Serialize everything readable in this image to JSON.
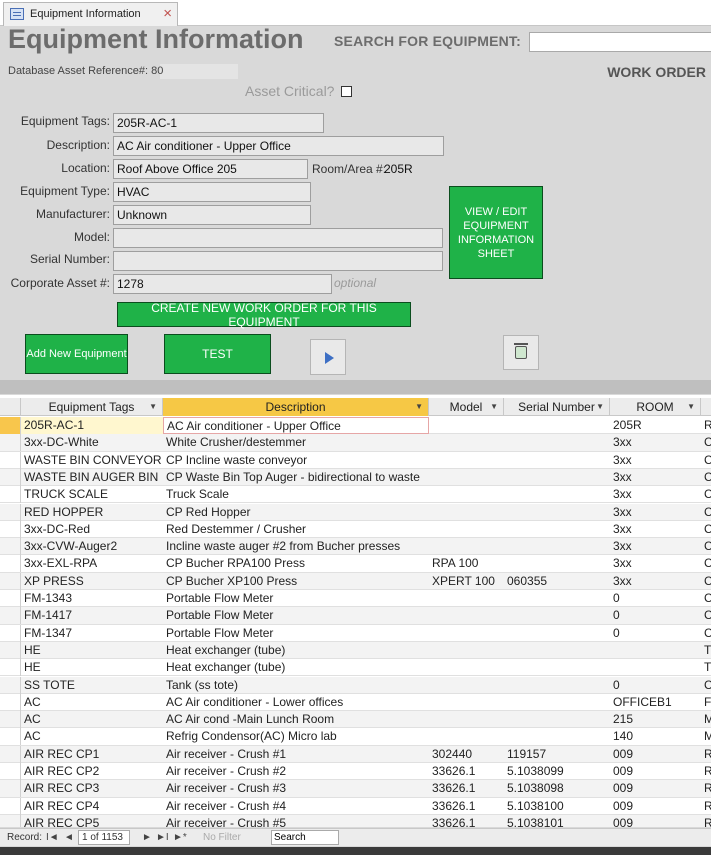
{
  "tab": {
    "label": "Equipment Information",
    "close": "×"
  },
  "header": {
    "title": "Equipment Information",
    "search_label": "SEARCH  FOR EQUIPMENT:",
    "search_value": ""
  },
  "db_ref": "Database Asset Reference#: 80",
  "work_order_label": "WORK ORDER",
  "asset_critical": {
    "label": "Asset Critical?",
    "checked": false
  },
  "fields": {
    "equipment_tags": {
      "label": "Equipment Tags:",
      "value": "205R-AC-1"
    },
    "description": {
      "label": "Description:",
      "value": "AC Air conditioner - Upper Office"
    },
    "location": {
      "label": "Location:",
      "value": "Roof Above Office 205"
    },
    "room_area": {
      "label": "Room/Area #:",
      "value": "205R"
    },
    "equipment_type": {
      "label": "Equipment Type:",
      "value": "HVAC"
    },
    "manufacturer": {
      "label": "Manufacturer:",
      "value": "Unknown"
    },
    "model": {
      "label": "Model:",
      "value": ""
    },
    "serial_number": {
      "label": "Serial Number:",
      "value": ""
    },
    "corporate_asset": {
      "label": "Corporate Asset #:",
      "value": "1278",
      "hint": "optional"
    }
  },
  "buttons": {
    "view_edit": "VIEW / EDIT EQUIPMENT INFORMATION SHEET",
    "create_work_order": "CREATE NEW WORK ORDER FOR THIS EQUIPMENT",
    "add_new": "Add New Equipment",
    "test": "TEST"
  },
  "colors": {
    "button_green": "#1fb248",
    "sorted_header": "#f6c845",
    "current_row": "#f8c64c"
  },
  "table": {
    "columns": [
      {
        "key": "tag",
        "label": "Equipment Tags"
      },
      {
        "key": "desc",
        "label": "Description"
      },
      {
        "key": "model",
        "label": "Model"
      },
      {
        "key": "serial",
        "label": "Serial Number"
      },
      {
        "key": "room",
        "label": "ROOM"
      },
      {
        "key": "extra",
        "label": ""
      }
    ],
    "rows": [
      [
        "205R-AC-1",
        "AC Air conditioner - Upper Office",
        "",
        "",
        "205R",
        "R"
      ],
      [
        "3xx-DC-White",
        "White Crusher/destemmer",
        "",
        "",
        "3xx",
        "C"
      ],
      [
        "WASTE BIN CONVEYOR",
        "CP Incline waste conveyor",
        "",
        "",
        "3xx",
        "C"
      ],
      [
        "WASTE BIN AUGER BIN",
        "CP Waste Bin Top Auger - bidirectional to waste",
        "",
        "",
        "3xx",
        "C"
      ],
      [
        "TRUCK SCALE",
        "Truck Scale",
        "",
        "",
        "3xx",
        "C"
      ],
      [
        "RED HOPPER",
        "CP Red Hopper",
        "",
        "",
        "3xx",
        "C"
      ],
      [
        "3xx-DC-Red",
        "Red Destemmer / Crusher",
        "",
        "",
        "3xx",
        "C"
      ],
      [
        "3xx-CVW-Auger2",
        "Incline waste auger #2 from Bucher presses",
        "",
        "",
        "3xx",
        "C"
      ],
      [
        "3xx-EXL-RPA",
        "CP Bucher RPA100 Press",
        "RPA 100",
        "",
        "3xx",
        "C"
      ],
      [
        "XP PRESS",
        "CP Bucher XP100 Press",
        "XPERT 100",
        "060355",
        "3xx",
        "C"
      ],
      [
        "FM-1343",
        "Portable Flow Meter",
        "",
        "",
        "0",
        "C"
      ],
      [
        "FM-1417",
        "Portable Flow Meter",
        "",
        "",
        "0",
        "C"
      ],
      [
        "FM-1347",
        "Portable Flow Meter",
        "",
        "",
        "0",
        "C"
      ],
      [
        "HE",
        "Heat exchanger (tube)",
        "",
        "",
        "",
        "T"
      ],
      [
        "HE",
        "Heat exchanger (tube)",
        "",
        "",
        "",
        "T"
      ],
      [
        "SS TOTE",
        "Tank (ss tote)",
        "",
        "",
        "0",
        "C"
      ],
      [
        "AC",
        "AC Air conditioner - Lower offices",
        "",
        "",
        "OFFICEB1",
        "F"
      ],
      [
        "AC",
        "AC Air cond -Main Lunch Room",
        "",
        "",
        "215",
        "M"
      ],
      [
        "AC",
        "Refrig Condensor(AC) Micro lab",
        "",
        "",
        "140",
        "M"
      ],
      [
        "AIR REC CP1",
        "Air receiver - Crush #1",
        "302440",
        "119157",
        "009",
        "R"
      ],
      [
        "AIR REC CP2",
        "Air receiver - Crush #2",
        "33626.1",
        "5.1038099",
        "009",
        "R"
      ],
      [
        "AIR REC CP3",
        "Air receiver - Crush #3",
        "33626.1",
        "5.1038098",
        "009",
        "R"
      ],
      [
        "AIR REC CP4",
        "Air receiver  - Crush #4",
        "33626.1",
        "5.1038100",
        "009",
        "R"
      ],
      [
        "AIR REC CP5",
        "Air receiver - Crush #5",
        "33626.1",
        "5.1038101",
        "009",
        "R"
      ]
    ]
  },
  "nav": {
    "record_label": "Record:",
    "first": "I◄",
    "prev": "◄",
    "position": "1 of 1153",
    "next": "►",
    "last": "►I",
    "new": "►*",
    "no_filter": "No Filter",
    "search_value": "Search"
  }
}
